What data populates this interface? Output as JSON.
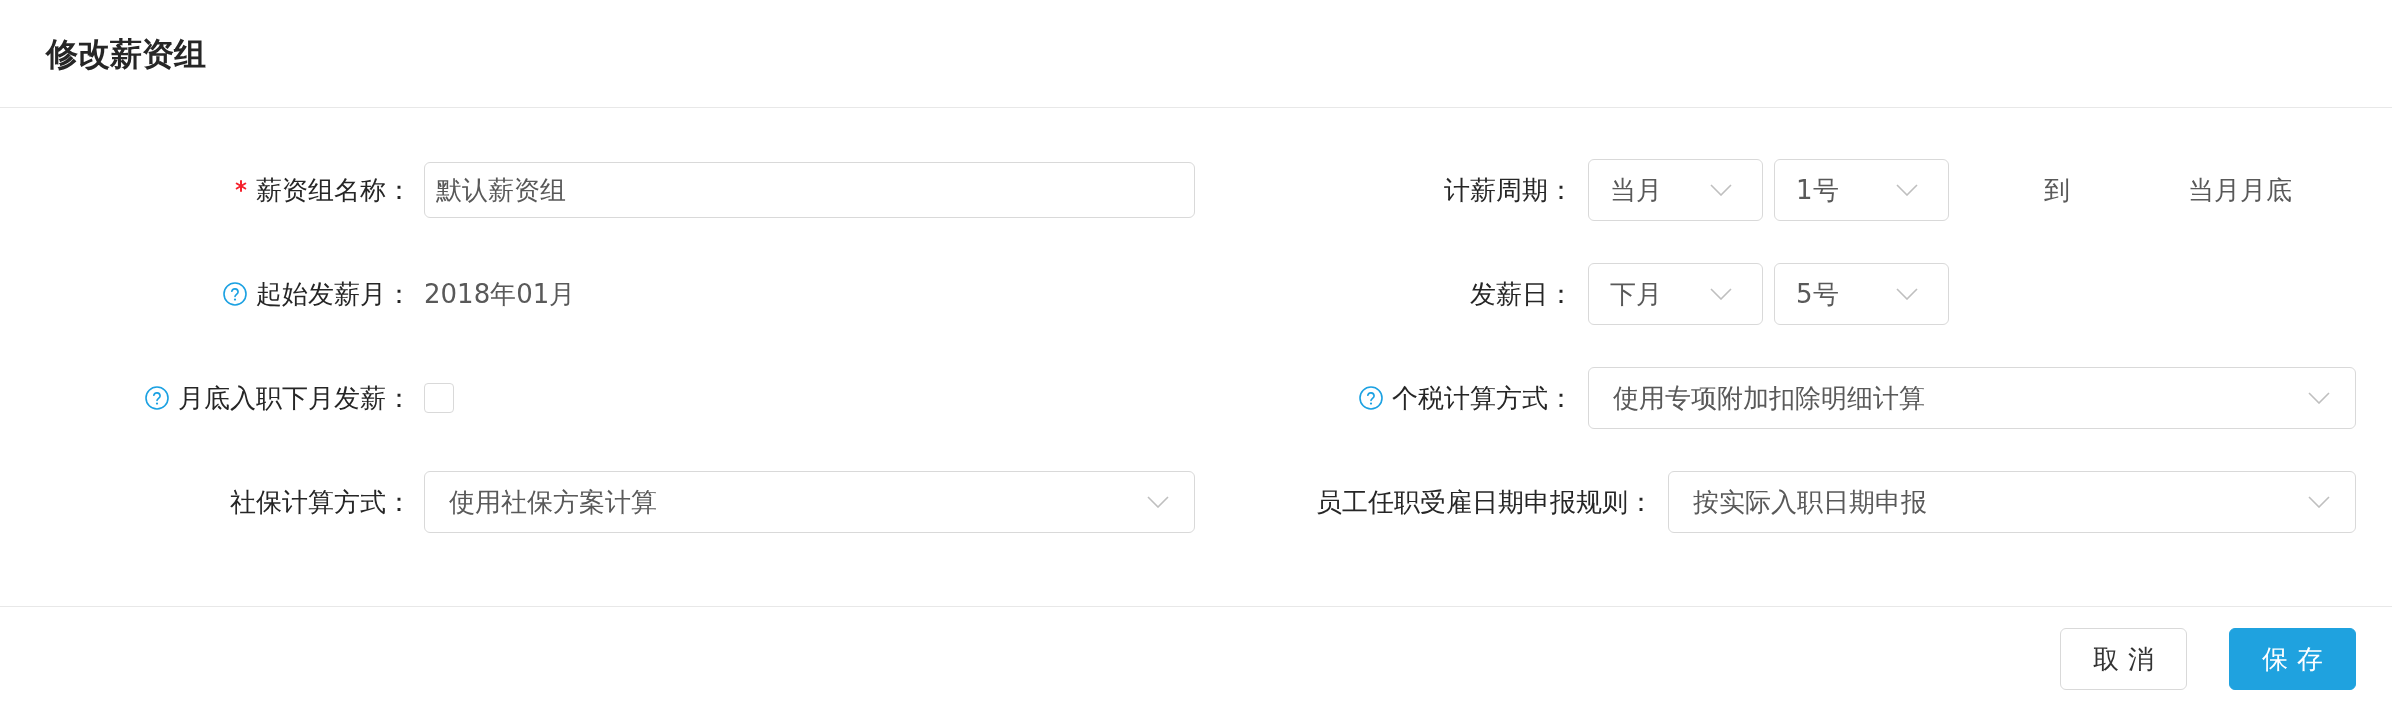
{
  "dialog": {
    "title": "修改薪资组"
  },
  "form": {
    "left": [
      {
        "kind": "text_input",
        "label": "薪资组名称：",
        "required": true,
        "help": false,
        "value": "默认薪资组"
      },
      {
        "kind": "static",
        "label": "起始发薪月：",
        "required": false,
        "help": true,
        "value": "2018年01月"
      },
      {
        "kind": "checkbox",
        "label": "月底入职下月发薪：",
        "required": false,
        "help": true,
        "checked": false
      },
      {
        "kind": "select",
        "label": "社保计算方式：",
        "required": false,
        "help": false,
        "value": "使用社保方案计算"
      }
    ],
    "right": [
      {
        "kind": "select_pair",
        "label": "计薪周期：",
        "required": false,
        "help": false,
        "selects": [
          "当月",
          "1号"
        ],
        "to": "到",
        "end": "当月月底"
      },
      {
        "kind": "select_pair",
        "label": "发薪日：",
        "required": false,
        "help": false,
        "selects": [
          "下月",
          "5号"
        ]
      },
      {
        "kind": "select",
        "label": "个税计算方式：",
        "required": false,
        "help": true,
        "value": "使用专项附加扣除明细计算"
      },
      {
        "kind": "select",
        "label": "员工任职受雇日期申报规则：",
        "required": false,
        "help": false,
        "value": "按实际入职日期申报"
      }
    ]
  },
  "buttons": [
    {
      "kind": "secondary",
      "label": "取 消"
    },
    {
      "kind": "primary",
      "label": "保 存"
    }
  ]
}
